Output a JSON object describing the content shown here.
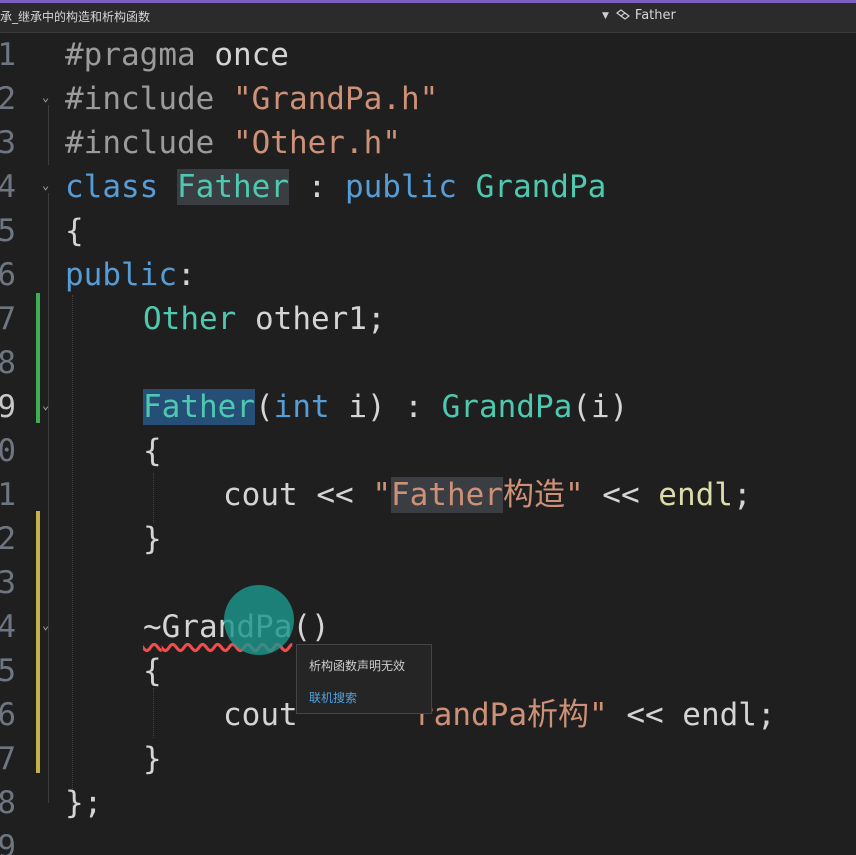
{
  "tab": {
    "file_title": "承_继承中的构造和析构函数",
    "symbol": "Father",
    "symbol_icon": "class-icon"
  },
  "editor": {
    "lines": [
      {
        "num": "1"
      },
      {
        "num": "2"
      },
      {
        "num": "3"
      },
      {
        "num": "4"
      },
      {
        "num": "5"
      },
      {
        "num": "6"
      },
      {
        "num": "7"
      },
      {
        "num": "8"
      },
      {
        "num": "9"
      },
      {
        "num": "0"
      },
      {
        "num": "1"
      },
      {
        "num": "2"
      },
      {
        "num": "3"
      },
      {
        "num": "4"
      },
      {
        "num": "5"
      },
      {
        "num": "6"
      },
      {
        "num": "7"
      },
      {
        "num": "8"
      },
      {
        "num": "9"
      }
    ],
    "tokens": {
      "l1_a": "#pragma",
      "l1_b": " once",
      "l2_a": "#include",
      "l2_b": " ",
      "l2_c": "\"GrandPa.h\"",
      "l3_a": "#include",
      "l3_b": " ",
      "l3_c": "\"Other.h\"",
      "l4_a": "class",
      "l4_b": " ",
      "l4_c": "Father",
      "l4_d": " : ",
      "l4_e": "public",
      "l4_f": " ",
      "l4_g": "GrandPa",
      "l5": "{",
      "l6_a": "public",
      "l6_b": ":",
      "l7_a": "Other",
      "l7_b": " other1;",
      "l9_a": "Father",
      "l9_b": "(",
      "l9_c": "int",
      "l9_d": " i) : ",
      "l9_e": "GrandPa",
      "l9_f": "(i)",
      "l10": "{",
      "l11_a": "cout << ",
      "l11_b": "\"",
      "l11_c": "Father",
      "l11_d": "构造\"",
      "l11_e": " << ",
      "l11_f": "endl",
      "l11_g": ";",
      "l12": "}",
      "l14_a": "~",
      "l14_b": "GrandPa",
      "l14_c": "()",
      "l15": "{",
      "l16_a": "cout",
      "l16_c": "randPa析构\"",
      "l16_d": " << endl;",
      "l17": "}",
      "l18": "};"
    }
  },
  "popup": {
    "message": "析构函数声明无效",
    "link": "联机搜索"
  },
  "colors": {
    "keyword": "#569cd6",
    "type": "#4ec9b0",
    "string": "#ce9178",
    "change_bar_saved": "#3fae51",
    "change_bar_unsaved": "#c5b049"
  }
}
